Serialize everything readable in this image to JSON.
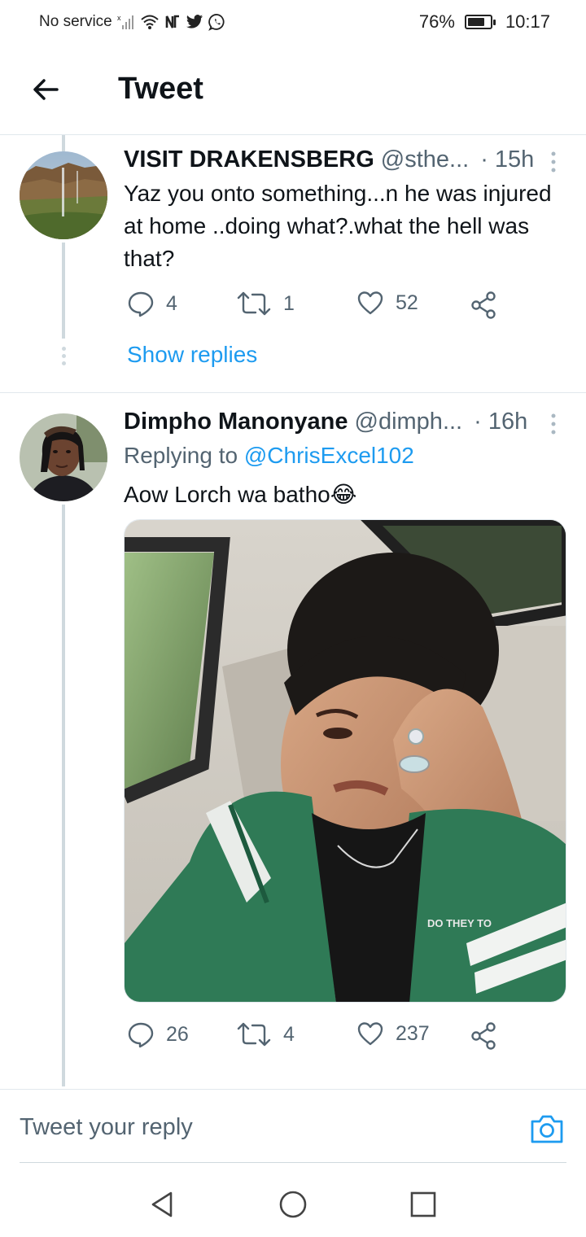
{
  "status_bar": {
    "carrier": "No service",
    "battery": "76%",
    "battery_level": 0.76,
    "time": "10:17",
    "icons": [
      "signal-icon",
      "wifi-icon",
      "nfc-icon",
      "twitter-icon",
      "whatsapp-icon"
    ]
  },
  "header": {
    "title": "Tweet",
    "back_icon": "arrow-left-icon"
  },
  "tweets": [
    {
      "name": "VISIT DRAKENSBERG",
      "handle": "@sthe...",
      "time": "· 15h",
      "text": "Yaz you onto something...n he was injured at home ..doing what?.what the hell was that?",
      "replies": "4",
      "retweets": "1",
      "likes": "52",
      "show_replies": "Show replies"
    },
    {
      "name": "Dimpho Manonyane",
      "handle": "@dimph...",
      "time": "· 16h",
      "replying_prefix": "Replying to",
      "replying_to": "@ChrisExcel102",
      "text": "Aow Lorch wa batho",
      "emoji": "😂",
      "replies": "26",
      "retweets": "4",
      "likes": "237",
      "media_text": "DO THEY TO"
    }
  ],
  "reply_bar": {
    "placeholder": "Tweet your reply",
    "camera_icon": "camera-icon"
  },
  "nav_bar": {
    "buttons": [
      "back-triangle-icon",
      "home-circle-icon",
      "recents-square-icon"
    ]
  },
  "colors": {
    "accent": "#1d9bf0",
    "secondary_text": "#536471",
    "divider": "#e1e8ed"
  }
}
